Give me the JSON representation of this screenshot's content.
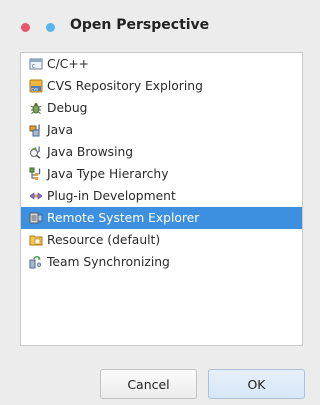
{
  "dialog": {
    "title": "Open Perspective"
  },
  "perspectives": [
    {
      "label": "C/C++",
      "icon": "cpp-perspective-icon"
    },
    {
      "label": "CVS Repository Exploring",
      "icon": "cvs-repository-icon"
    },
    {
      "label": "Debug",
      "icon": "debug-bug-icon"
    },
    {
      "label": "Java",
      "icon": "java-perspective-icon"
    },
    {
      "label": "Java Browsing",
      "icon": "java-browsing-icon"
    },
    {
      "label": "Java Type Hierarchy",
      "icon": "type-hierarchy-icon"
    },
    {
      "label": "Plug-in Development",
      "icon": "plugin-development-icon"
    },
    {
      "label": "Remote System Explorer",
      "icon": "remote-system-explorer-icon",
      "selected": true
    },
    {
      "label": "Resource (default)",
      "icon": "resource-folder-icon"
    },
    {
      "label": "Team Synchronizing",
      "icon": "team-synchronizing-icon"
    }
  ],
  "buttons": {
    "cancel": "Cancel",
    "ok": "OK"
  },
  "colors": {
    "selection": "#3d8fe0",
    "close_dot": "#e9546b",
    "minimize_dot": "#58b6e8"
  }
}
